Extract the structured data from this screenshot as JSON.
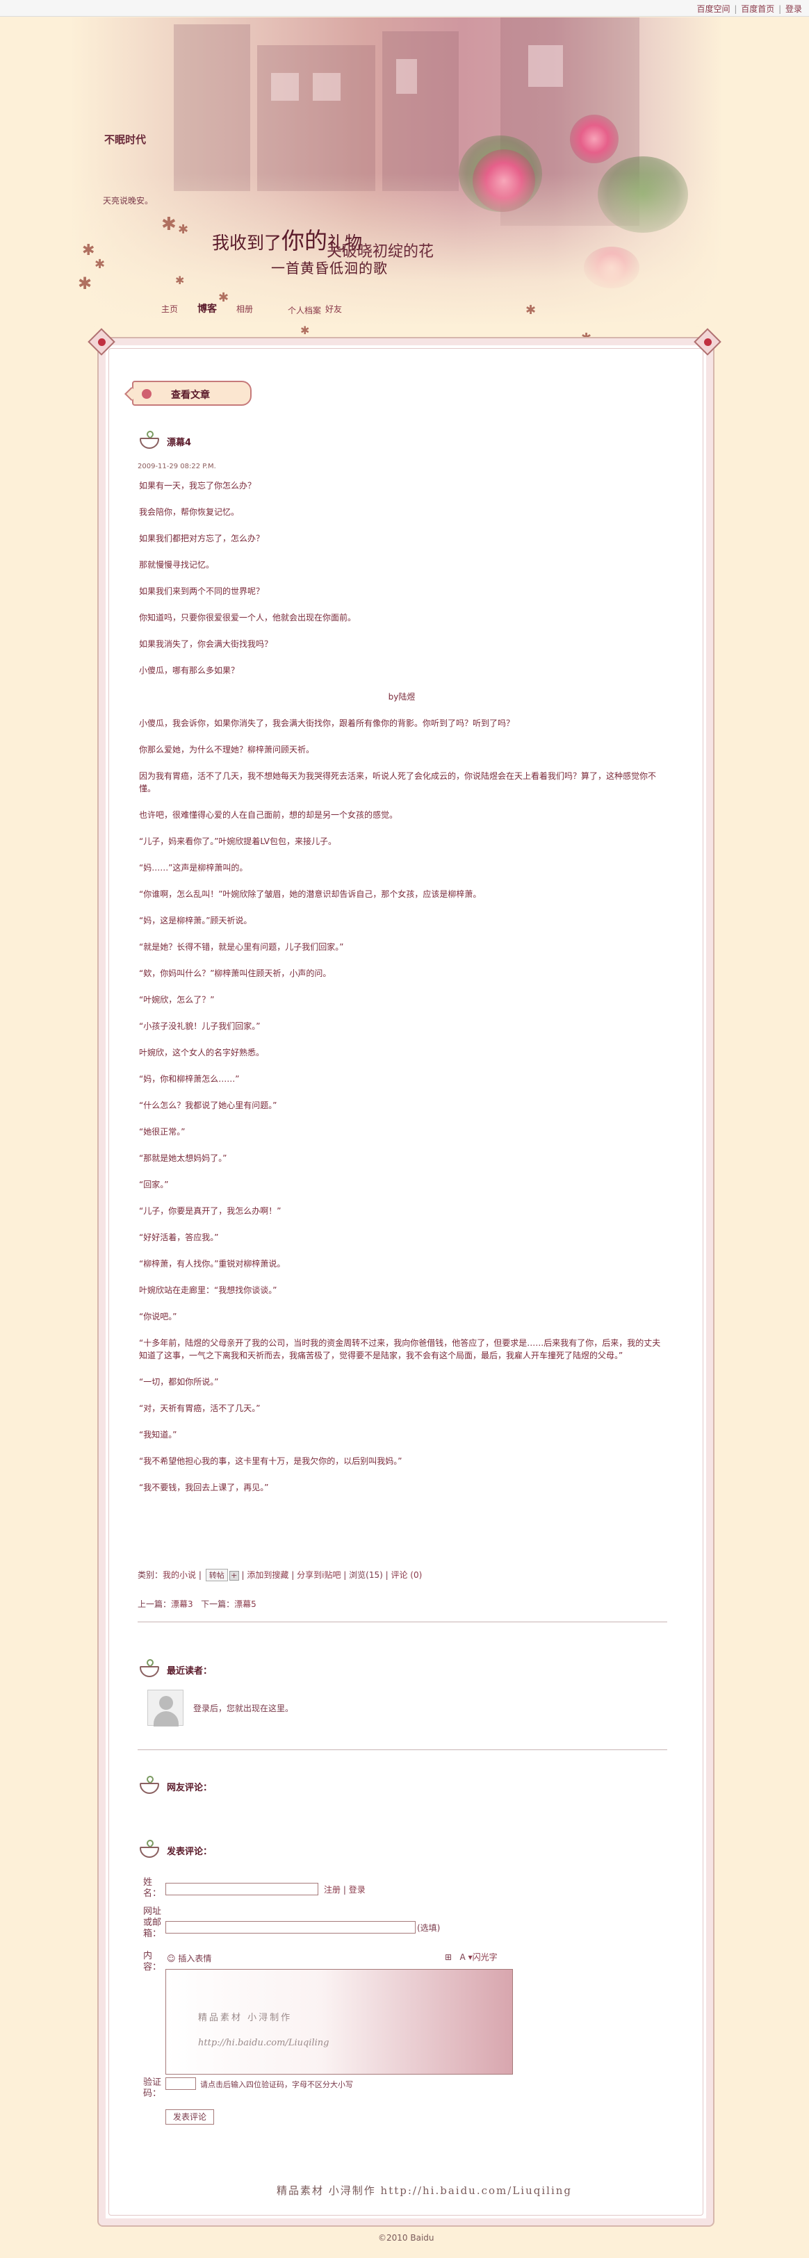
{
  "topbar": {
    "links": [
      "百度空间",
      "百度首页",
      "登录"
    ],
    "sep": "|"
  },
  "site": {
    "title": "不眠时代",
    "desc": "天亮说晚安。",
    "slogan": {
      "part1": "我收到了",
      "part2": "你的",
      "part3": "礼物",
      "line2": "关破晓初绽的花",
      "line3": "一首黄昏低洄的歌"
    }
  },
  "nav": [
    "主页",
    "博客",
    "相册",
    "个人档案",
    "好友"
  ],
  "category_title": "查看文章",
  "post": {
    "title": "漂幕4",
    "date": "2009-11-29 08:22 P.M.",
    "paragraphs": [
      "如果有一天，我忘了你怎么办？",
      "我会陪你，帮你恢复记忆。",
      "如果我们都把对方忘了，怎么办？",
      "那就慢慢寻找记忆。",
      "如果我们来到两个不同的世界呢？",
      "你知道吗，只要你很爱很爱一个人，他就会出现在你面前。",
      "如果我消失了，你会满大街找我吗？",
      "小傻瓜，哪有那么多如果？",
      "by陆煜",
      "小傻瓜，我会诉你，如果你消失了，我会满大街找你，跟着所有像你的背影。你听到了吗？听到了吗？",
      "你那么爱她，为什么不理她？柳梓萧问顾天祈。",
      "因为我有胃癌，活不了几天，我不想她每天为我哭得死去活来，听说人死了会化成云的，你说陆煜会在天上看着我们吗？算了，这种感觉你不懂。",
      "也许吧，很难懂得心爱的人在自己面前，想的却是另一个女孩的感觉。",
      "“儿子，妈来看你了。”叶婉欣提着LV包包，来接儿子。",
      "“妈……”这声是柳梓萧叫的。",
      "“你谁啊，怎么乱叫！”叶婉欣除了皱眉，她的潜意识却告诉自己，那个女孩，应该是柳梓萧。",
      "“妈，这是柳梓萧。”顾天祈说。",
      "“就是她？长得不错，就是心里有问题，儿子我们回家。”",
      "“欸，你妈叫什么？”柳梓萧叫住顾天祈，小声的问。",
      "“叶婉欣，怎么了？”",
      "“小孩子没礼貌！儿子我们回家。”",
      "叶婉欣，这个女人的名字好熟悉。",
      "“妈，你和柳梓萧怎么……”",
      "“什么怎么？我都说了她心里有问题。”",
      "“她很正常。”",
      "“那就是她太想妈妈了。”",
      "“回家。”",
      "“儿子，你要是真开了，我怎么办啊！”",
      "“好好活着，答应我。”",
      "“柳梓萧，有人找你。”重锐对柳梓萧说。",
      "叶婉欣站在走廊里：“我想找你谈谈。”",
      "“你说吧。”",
      "“十多年前，陆煜的父母亲开了我的公司，当时我的资金周转不过来，我向你爸借钱，他答应了，但要求是……后来我有了你，后来，我的丈夫知道了这事，一气之下离我和天祈而去，我痛苦极了，觉得要不是陆家，我不会有这个局面，最后，我雇人开车撞死了陆煜的父母。”",
      "“一切，都如你所说。”",
      "“对，天祈有胃癌，活不了几天。”",
      "“我知道。”",
      "“我不希望他担心我的事，这卡里有十万，是我欠你的，以后别叫我妈。”",
      "“我不要钱，我回去上课了，再见。”"
    ],
    "center_index": 8
  },
  "meta": {
    "category_label": "类别：",
    "category": "我的小说",
    "tag_label": "转帖",
    "tag_plus": "+",
    "actions": [
      "添加到搜藏",
      "分享到i贴吧",
      "浏览(15)",
      "评论 (0)"
    ]
  },
  "prevnext": {
    "prev_label": "上一篇：",
    "prev": "漂幕3",
    "next_label": "下一篇：",
    "next": "漂幕5"
  },
  "visitors": {
    "title": "最近读者：",
    "message": "登录后，您就出现在这里。"
  },
  "comments": {
    "title": "网友评论："
  },
  "comment_form": {
    "title": "发表评论：",
    "name_label": "姓名：",
    "register": "注册",
    "login": "登录",
    "url_label": "网址或邮箱：",
    "optional": "(选填)",
    "content_label": "内容：",
    "insert_emote": "插入表情",
    "rich_text": "闪光字",
    "watermark1": "精品素材 小浔制作",
    "watermark2": "http://hi.baidu.com/Liuqiling",
    "captcha_label": "验证码：",
    "captcha_hint": "请点击后输入四位验证码，字母不区分大小写",
    "submit": "发表评论"
  },
  "footer": {
    "signature": "精品素材 小浔制作 http://hi.baidu.com/Liuqiling",
    "copyright": "©2010 Baidu"
  },
  "colors": {
    "background": "#fdf0d8",
    "accent": "#7a2a3a",
    "frame_border": "#d6b6ac"
  }
}
